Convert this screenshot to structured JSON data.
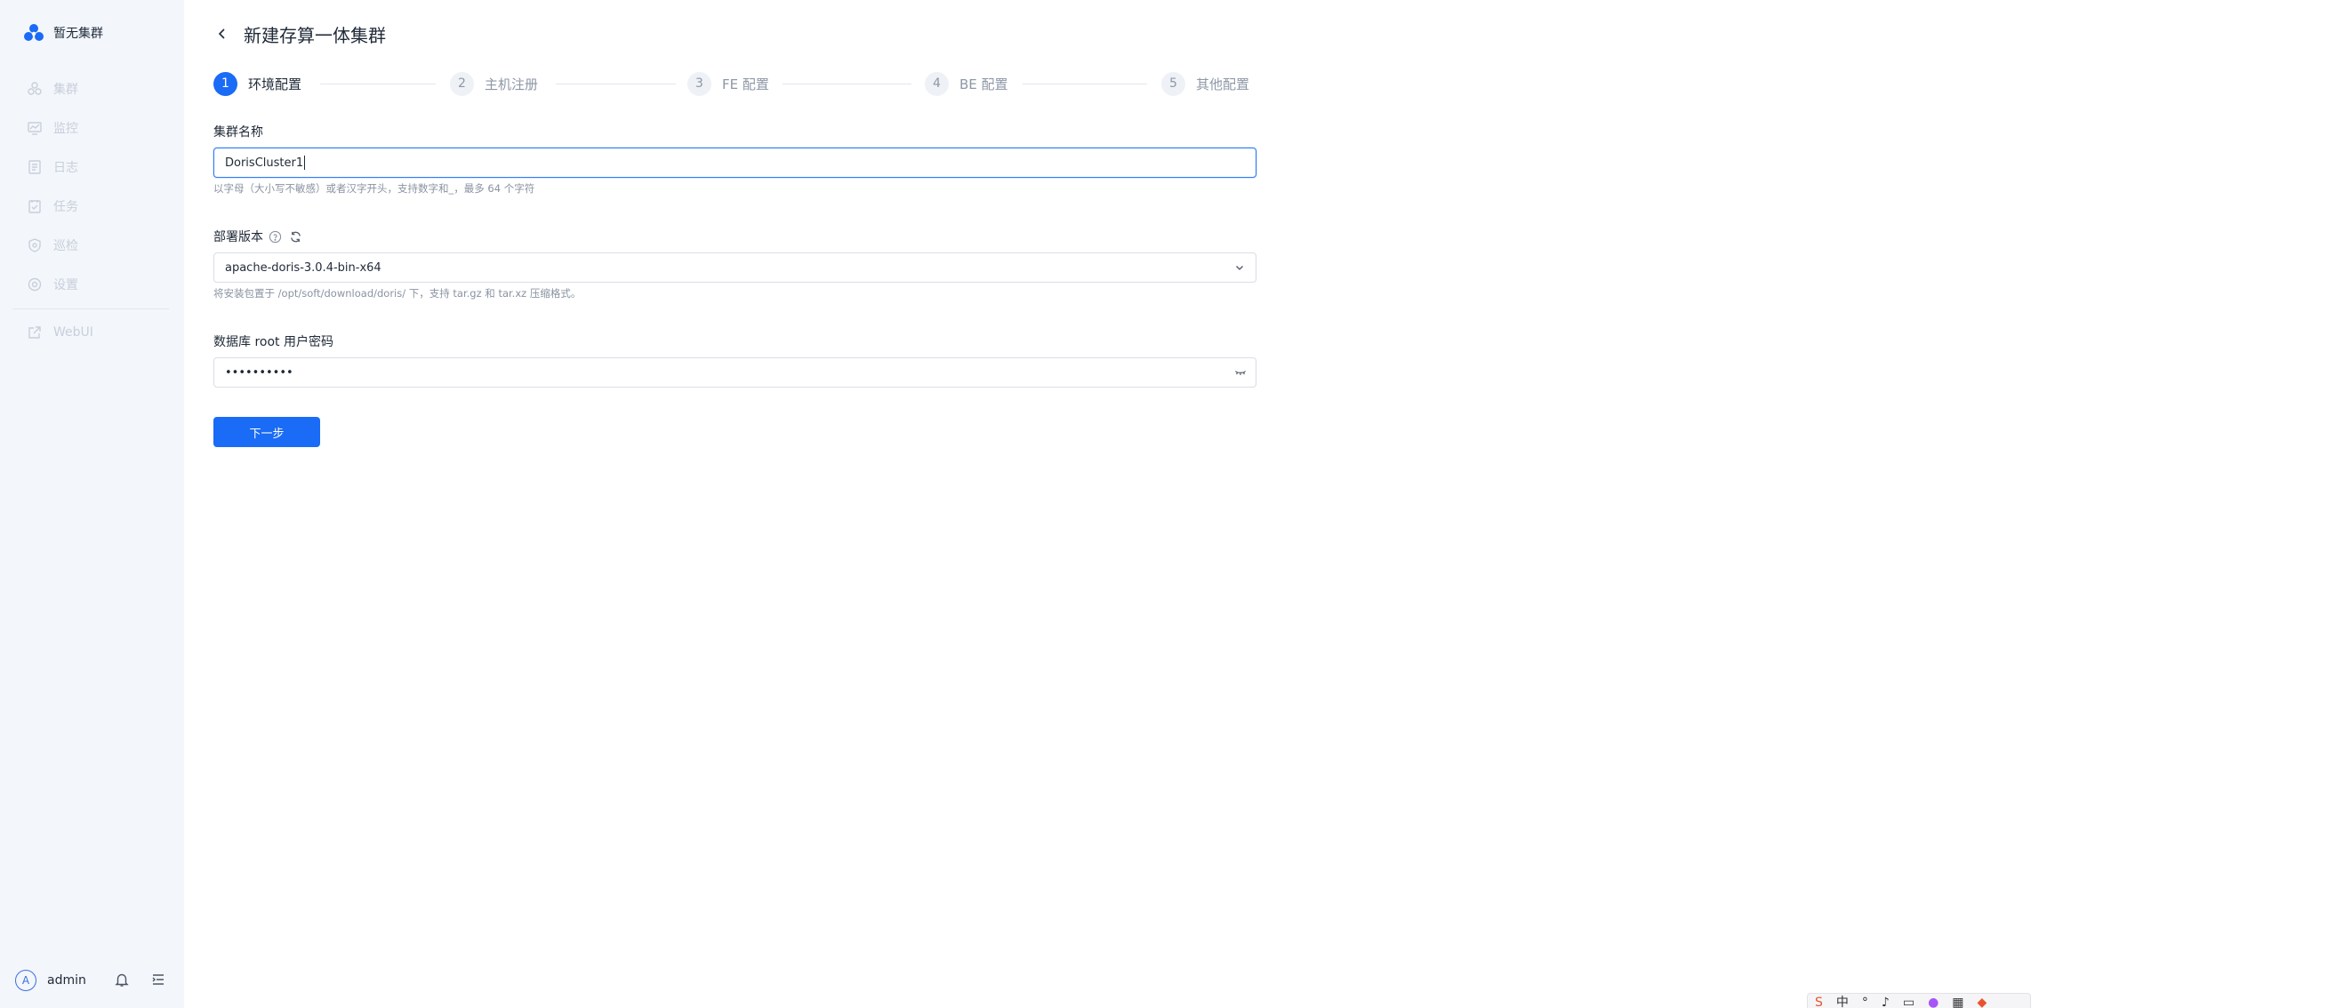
{
  "app": {
    "brand_name": "暂无集群"
  },
  "sidebar": {
    "items": [
      {
        "label": "集群",
        "icon": "cluster-icon"
      },
      {
        "label": "监控",
        "icon": "monitor-icon"
      },
      {
        "label": "日志",
        "icon": "log-icon"
      },
      {
        "label": "任务",
        "icon": "task-icon"
      },
      {
        "label": "巡检",
        "icon": "inspect-icon"
      },
      {
        "label": "设置",
        "icon": "settings-icon"
      }
    ],
    "webui_label": "WebUI",
    "user": {
      "avatar_letter": "A",
      "name": "admin"
    }
  },
  "header": {
    "title": "新建存算一体集群"
  },
  "steps": [
    {
      "num": "1",
      "label": "环境配置",
      "active": true
    },
    {
      "num": "2",
      "label": "主机注册",
      "active": false
    },
    {
      "num": "3",
      "label": "FE 配置",
      "active": false
    },
    {
      "num": "4",
      "label": "BE 配置",
      "active": false
    },
    {
      "num": "5",
      "label": "其他配置",
      "active": false
    }
  ],
  "form": {
    "cluster_name": {
      "label": "集群名称",
      "value": "DorisCluster1",
      "hint": "以字母（大小写不敏感）或者汉字开头，支持数字和_，最多 64 个字符"
    },
    "version": {
      "label": "部署版本",
      "value": "apache-doris-3.0.4-bin-x64",
      "hint": "将安装包置于 /opt/soft/download/doris/ 下，支持 tar.gz 和 tar.xz 压缩格式。"
    },
    "password": {
      "label": "数据库 root 用户密码",
      "masked_value": "••••••••••"
    },
    "next_button": "下一步"
  },
  "tray": {
    "ime_label": "中"
  },
  "colors": {
    "primary": "#1a6bf5",
    "sidebar_bg": "#f3f6fb"
  }
}
